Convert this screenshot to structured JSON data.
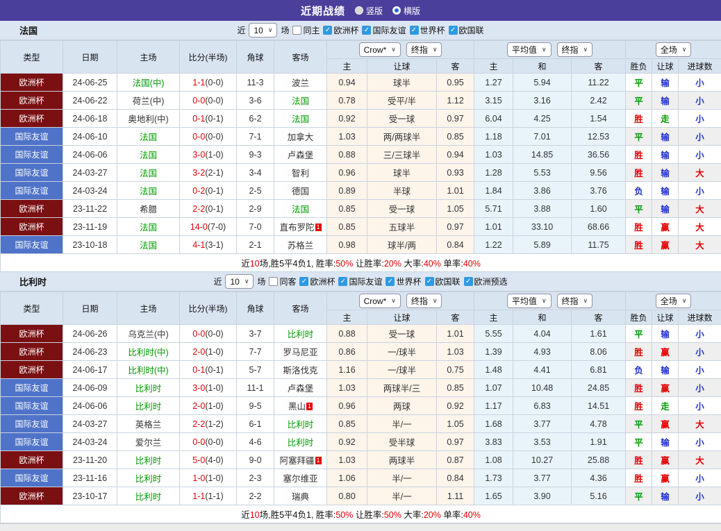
{
  "titlebar": {
    "title": "近期战绩",
    "radios": [
      {
        "label": "竖版",
        "checked": false
      },
      {
        "label": "横版",
        "checked": true
      }
    ]
  },
  "table_header": {
    "base": [
      "类型",
      "日期",
      "主场",
      "比分(半场)",
      "角球",
      "客场"
    ],
    "odds_selects": [
      "Crow*",
      "终指"
    ],
    "odds_cols": [
      "主",
      "让球",
      "客"
    ],
    "avg_selects": [
      "平均值",
      "终指"
    ],
    "avg_cols": [
      "主",
      "和",
      "客"
    ],
    "full_select": "全场",
    "full_cols": [
      "胜负",
      "让球",
      "进球数"
    ]
  },
  "colors": {
    "red": "#e60000",
    "green": "#009900",
    "blue": "#2233cc",
    "accent_purple": "#4b3f9c",
    "league": {
      "欧洲杯": "#7b1013",
      "国际友谊": "#4f73c8"
    }
  },
  "sections": [
    {
      "team": "法国",
      "filter": {
        "near_label": "近",
        "count": "10",
        "games_label": "场",
        "same_label": "同主",
        "same_checked": false,
        "leagues": [
          "欧洲杯",
          "国际友谊",
          "世界杯",
          "欧国联"
        ]
      },
      "rows": [
        {
          "league": "欧洲杯",
          "date": "24-06-25",
          "home": {
            "name": "法国(中)",
            "green": true
          },
          "score": {
            "ft": "1-1",
            "ht": "(0-0)"
          },
          "corner": "11-3",
          "away": {
            "name": "波兰",
            "green": false
          },
          "odds": [
            "0.94",
            "球半",
            "0.95"
          ],
          "avg": [
            "1.27",
            "5.94",
            "11.22"
          ],
          "results": [
            {
              "t": "平",
              "c": "g"
            },
            {
              "t": "输",
              "c": "b"
            },
            {
              "t": "小",
              "c": "b"
            }
          ]
        },
        {
          "league": "欧洲杯",
          "date": "24-06-22",
          "home": {
            "name": "荷兰(中)",
            "green": false
          },
          "score": {
            "ft": "0-0",
            "ht": "(0-0)"
          },
          "corner": "3-6",
          "away": {
            "name": "法国",
            "green": true
          },
          "odds": [
            "0.78",
            "受平/半",
            "1.12"
          ],
          "avg": [
            "3.15",
            "3.16",
            "2.42"
          ],
          "results": [
            {
              "t": "平",
              "c": "g"
            },
            {
              "t": "输",
              "c": "b"
            },
            {
              "t": "小",
              "c": "b"
            }
          ]
        },
        {
          "league": "欧洲杯",
          "date": "24-06-18",
          "home": {
            "name": "奥地利(中)",
            "green": false
          },
          "score": {
            "ft": "0-1",
            "ht": "(0-1)"
          },
          "corner": "6-2",
          "away": {
            "name": "法国",
            "green": true
          },
          "odds": [
            "0.92",
            "受一球",
            "0.97"
          ],
          "avg": [
            "6.04",
            "4.25",
            "1.54"
          ],
          "results": [
            {
              "t": "胜",
              "c": "r"
            },
            {
              "t": "走",
              "c": "g"
            },
            {
              "t": "小",
              "c": "b"
            }
          ]
        },
        {
          "league": "国际友谊",
          "date": "24-06-10",
          "home": {
            "name": "法国",
            "green": true
          },
          "score": {
            "ft": "0-0",
            "ht": "(0-0)"
          },
          "corner": "7-1",
          "away": {
            "name": "加拿大",
            "green": false
          },
          "odds": [
            "1.03",
            "两/两球半",
            "0.85"
          ],
          "avg": [
            "1.18",
            "7.01",
            "12.53"
          ],
          "results": [
            {
              "t": "平",
              "c": "g"
            },
            {
              "t": "输",
              "c": "b"
            },
            {
              "t": "小",
              "c": "b"
            }
          ]
        },
        {
          "league": "国际友谊",
          "date": "24-06-06",
          "home": {
            "name": "法国",
            "green": true
          },
          "score": {
            "ft": "3-0",
            "ht": "(1-0)"
          },
          "corner": "9-3",
          "away": {
            "name": "卢森堡",
            "green": false
          },
          "odds": [
            "0.88",
            "三/三球半",
            "0.94"
          ],
          "avg": [
            "1.03",
            "14.85",
            "36.56"
          ],
          "results": [
            {
              "t": "胜",
              "c": "r"
            },
            {
              "t": "输",
              "c": "b"
            },
            {
              "t": "小",
              "c": "b"
            }
          ]
        },
        {
          "league": "国际友谊",
          "date": "24-03-27",
          "home": {
            "name": "法国",
            "green": true
          },
          "score": {
            "ft": "3-2",
            "ht": "(2-1)"
          },
          "corner": "3-4",
          "away": {
            "name": "智利",
            "green": false
          },
          "odds": [
            "0.96",
            "球半",
            "0.93"
          ],
          "avg": [
            "1.28",
            "5.53",
            "9.56"
          ],
          "results": [
            {
              "t": "胜",
              "c": "r"
            },
            {
              "t": "输",
              "c": "b"
            },
            {
              "t": "大",
              "c": "r"
            }
          ]
        },
        {
          "league": "国际友谊",
          "date": "24-03-24",
          "home": {
            "name": "法国",
            "green": true
          },
          "score": {
            "ft": "0-2",
            "ht": "(0-1)"
          },
          "corner": "2-5",
          "away": {
            "name": "德国",
            "green": false
          },
          "odds": [
            "0.89",
            "半球",
            "1.01"
          ],
          "avg": [
            "1.84",
            "3.86",
            "3.76"
          ],
          "results": [
            {
              "t": "负",
              "c": "b"
            },
            {
              "t": "输",
              "c": "b"
            },
            {
              "t": "小",
              "c": "b"
            }
          ]
        },
        {
          "league": "欧洲杯",
          "date": "23-11-22",
          "home": {
            "name": "希腊",
            "green": false
          },
          "score": {
            "ft": "2-2",
            "ht": "(0-1)"
          },
          "corner": "2-9",
          "away": {
            "name": "法国",
            "green": true
          },
          "odds": [
            "0.85",
            "受一球",
            "1.05"
          ],
          "avg": [
            "5.71",
            "3.88",
            "1.60"
          ],
          "results": [
            {
              "t": "平",
              "c": "g"
            },
            {
              "t": "输",
              "c": "b"
            },
            {
              "t": "大",
              "c": "r"
            }
          ]
        },
        {
          "league": "欧洲杯",
          "date": "23-11-19",
          "home": {
            "name": "法国",
            "green": true
          },
          "score": {
            "ft": "14-0",
            "ht": "(7-0)"
          },
          "corner": "7-0",
          "away": {
            "name": "直布罗陀",
            "green": false,
            "sup": "1"
          },
          "odds": [
            "0.85",
            "五球半",
            "0.97"
          ],
          "avg": [
            "1.01",
            "33.10",
            "68.66"
          ],
          "results": [
            {
              "t": "胜",
              "c": "r"
            },
            {
              "t": "赢",
              "c": "r"
            },
            {
              "t": "大",
              "c": "r"
            }
          ]
        },
        {
          "league": "国际友谊",
          "date": "23-10-18",
          "home": {
            "name": "法国",
            "green": true
          },
          "score": {
            "ft": "4-1",
            "ht": "(3-1)"
          },
          "corner": "2-1",
          "away": {
            "name": "苏格兰",
            "green": false
          },
          "odds": [
            "0.98",
            "球半/两",
            "0.84"
          ],
          "avg": [
            "1.22",
            "5.89",
            "11.75"
          ],
          "results": [
            {
              "t": "胜",
              "c": "r"
            },
            {
              "t": "赢",
              "c": "r"
            },
            {
              "t": "大",
              "c": "r"
            }
          ]
        }
      ],
      "summary": [
        {
          "text": "近",
          "red": false
        },
        {
          "text": "10",
          "red": true
        },
        {
          "text": "场,胜5平4负1, 胜率:",
          "red": false
        },
        {
          "text": "50%",
          "red": true
        },
        {
          "text": " 让胜率:",
          "red": false
        },
        {
          "text": "20%",
          "red": true
        },
        {
          "text": " 大率:",
          "red": false
        },
        {
          "text": "40%",
          "red": true
        },
        {
          "text": " 单率:",
          "red": false
        },
        {
          "text": "40%",
          "red": true
        }
      ]
    },
    {
      "team": "比利时",
      "filter": {
        "near_label": "近",
        "count": "10",
        "games_label": "场",
        "same_label": "同客",
        "same_checked": false,
        "leagues": [
          "欧洲杯",
          "国际友谊",
          "世界杯",
          "欧国联",
          "欧洲预选"
        ]
      },
      "rows": [
        {
          "league": "欧洲杯",
          "date": "24-06-26",
          "home": {
            "name": "乌克兰(中)",
            "green": false
          },
          "score": {
            "ft": "0-0",
            "ht": "(0-0)"
          },
          "corner": "3-7",
          "away": {
            "name": "比利时",
            "green": true
          },
          "odds": [
            "0.88",
            "受一球",
            "1.01"
          ],
          "avg": [
            "5.55",
            "4.04",
            "1.61"
          ],
          "results": [
            {
              "t": "平",
              "c": "g"
            },
            {
              "t": "输",
              "c": "b"
            },
            {
              "t": "小",
              "c": "b"
            }
          ]
        },
        {
          "league": "欧洲杯",
          "date": "24-06-23",
          "home": {
            "name": "比利时(中)",
            "green": true
          },
          "score": {
            "ft": "2-0",
            "ht": "(1-0)"
          },
          "corner": "7-7",
          "away": {
            "name": "罗马尼亚",
            "green": false
          },
          "odds": [
            "0.86",
            "一/球半",
            "1.03"
          ],
          "avg": [
            "1.39",
            "4.93",
            "8.06"
          ],
          "results": [
            {
              "t": "胜",
              "c": "r"
            },
            {
              "t": "赢",
              "c": "r"
            },
            {
              "t": "小",
              "c": "b"
            }
          ]
        },
        {
          "league": "欧洲杯",
          "date": "24-06-17",
          "home": {
            "name": "比利时(中)",
            "green": true
          },
          "score": {
            "ft": "0-1",
            "ht": "(0-1)"
          },
          "corner": "5-7",
          "away": {
            "name": "斯洛伐克",
            "green": false
          },
          "odds": [
            "1.16",
            "一/球半",
            "0.75"
          ],
          "avg": [
            "1.48",
            "4.41",
            "6.81"
          ],
          "results": [
            {
              "t": "负",
              "c": "b"
            },
            {
              "t": "输",
              "c": "b"
            },
            {
              "t": "小",
              "c": "b"
            }
          ]
        },
        {
          "league": "国际友谊",
          "date": "24-06-09",
          "home": {
            "name": "比利时",
            "green": true
          },
          "score": {
            "ft": "3-0",
            "ht": "(1-0)"
          },
          "corner": "11-1",
          "away": {
            "name": "卢森堡",
            "green": false
          },
          "odds": [
            "1.03",
            "两球半/三",
            "0.85"
          ],
          "avg": [
            "1.07",
            "10.48",
            "24.85"
          ],
          "results": [
            {
              "t": "胜",
              "c": "r"
            },
            {
              "t": "赢",
              "c": "r"
            },
            {
              "t": "小",
              "c": "b"
            }
          ]
        },
        {
          "league": "国际友谊",
          "date": "24-06-06",
          "home": {
            "name": "比利时",
            "green": true
          },
          "score": {
            "ft": "2-0",
            "ht": "(1-0)"
          },
          "corner": "9-5",
          "away": {
            "name": "黑山",
            "green": false,
            "sup": "1"
          },
          "odds": [
            "0.96",
            "两球",
            "0.92"
          ],
          "avg": [
            "1.17",
            "6.83",
            "14.51"
          ],
          "results": [
            {
              "t": "胜",
              "c": "r"
            },
            {
              "t": "走",
              "c": "g"
            },
            {
              "t": "小",
              "c": "b"
            }
          ]
        },
        {
          "league": "国际友谊",
          "date": "24-03-27",
          "home": {
            "name": "英格兰",
            "green": false
          },
          "score": {
            "ft": "2-2",
            "ht": "(1-2)"
          },
          "corner": "6-1",
          "away": {
            "name": "比利时",
            "green": true
          },
          "odds": [
            "0.85",
            "半/一",
            "1.05"
          ],
          "avg": [
            "1.68",
            "3.77",
            "4.78"
          ],
          "results": [
            {
              "t": "平",
              "c": "g"
            },
            {
              "t": "赢",
              "c": "r"
            },
            {
              "t": "大",
              "c": "r"
            }
          ]
        },
        {
          "league": "国际友谊",
          "date": "24-03-24",
          "home": {
            "name": "爱尔兰",
            "green": false
          },
          "score": {
            "ft": "0-0",
            "ht": "(0-0)"
          },
          "corner": "4-6",
          "away": {
            "name": "比利时",
            "green": true
          },
          "odds": [
            "0.92",
            "受半球",
            "0.97"
          ],
          "avg": [
            "3.83",
            "3.53",
            "1.91"
          ],
          "results": [
            {
              "t": "平",
              "c": "g"
            },
            {
              "t": "输",
              "c": "b"
            },
            {
              "t": "小",
              "c": "b"
            }
          ]
        },
        {
          "league": "欧洲杯",
          "date": "23-11-20",
          "home": {
            "name": "比利时",
            "green": true
          },
          "score": {
            "ft": "5-0",
            "ht": "(4-0)"
          },
          "corner": "9-0",
          "away": {
            "name": "阿塞拜疆",
            "green": false,
            "sup": "1"
          },
          "odds": [
            "1.03",
            "两球半",
            "0.87"
          ],
          "avg": [
            "1.08",
            "10.27",
            "25.88"
          ],
          "results": [
            {
              "t": "胜",
              "c": "r"
            },
            {
              "t": "赢",
              "c": "r"
            },
            {
              "t": "大",
              "c": "r"
            }
          ]
        },
        {
          "league": "国际友谊",
          "date": "23-11-16",
          "home": {
            "name": "比利时",
            "green": true
          },
          "score": {
            "ft": "1-0",
            "ht": "(1-0)"
          },
          "corner": "2-3",
          "away": {
            "name": "塞尔维亚",
            "green": false
          },
          "odds": [
            "1.06",
            "半/一",
            "0.84"
          ],
          "avg": [
            "1.73",
            "3.77",
            "4.36"
          ],
          "results": [
            {
              "t": "胜",
              "c": "r"
            },
            {
              "t": "赢",
              "c": "r"
            },
            {
              "t": "小",
              "c": "b"
            }
          ]
        },
        {
          "league": "欧洲杯",
          "date": "23-10-17",
          "home": {
            "name": "比利时",
            "green": true
          },
          "score": {
            "ft": "1-1",
            "ht": "(1-1)"
          },
          "corner": "2-2",
          "away": {
            "name": "瑞典",
            "green": false
          },
          "odds": [
            "0.80",
            "半/一",
            "1.11"
          ],
          "avg": [
            "1.65",
            "3.90",
            "5.16"
          ],
          "results": [
            {
              "t": "平",
              "c": "g"
            },
            {
              "t": "输",
              "c": "b"
            },
            {
              "t": "小",
              "c": "b"
            }
          ]
        }
      ],
      "summary": [
        {
          "text": "近",
          "red": false
        },
        {
          "text": "10",
          "red": true
        },
        {
          "text": "场,胜5平4负1, 胜率:",
          "red": false
        },
        {
          "text": "50%",
          "red": true
        },
        {
          "text": " 让胜率:",
          "red": false
        },
        {
          "text": "50%",
          "red": true
        },
        {
          "text": " 大率:",
          "red": false
        },
        {
          "text": "20%",
          "red": true
        },
        {
          "text": " 单率:",
          "red": false
        },
        {
          "text": "40%",
          "red": true
        }
      ]
    }
  ]
}
